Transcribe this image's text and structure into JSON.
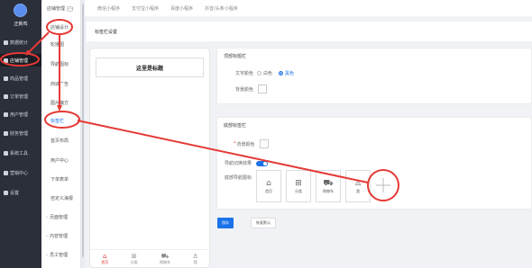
{
  "sidebar": {
    "shop_name": "正新鸡",
    "items": [
      {
        "label": "数据统计"
      },
      {
        "label": "店铺管理"
      },
      {
        "label": "商品管理"
      },
      {
        "label": "订单管理"
      },
      {
        "label": "用户管理"
      },
      {
        "label": "财务管理"
      },
      {
        "label": "系统工具"
      },
      {
        "label": "营销中心"
      },
      {
        "label": "设置"
      }
    ]
  },
  "submenu": {
    "title": "店铺管理",
    "collapse": "<<",
    "items": [
      {
        "label": "店铺设计"
      },
      {
        "label": "轮播图"
      },
      {
        "label": "导航图标"
      },
      {
        "label": "商城广告"
      },
      {
        "label": "图片魔方"
      },
      {
        "label": "标签栏"
      },
      {
        "label": "首页布局"
      },
      {
        "label": "用户中心"
      },
      {
        "label": "下单表单"
      },
      {
        "label": "自定义海报"
      },
      {
        "label": "页面管理"
      },
      {
        "label": "内容管理"
      },
      {
        "label": "员工管理"
      }
    ]
  },
  "top_tabs": [
    "微信小程序",
    "支付宝小程序",
    "百度小程序",
    "抖音/头条小程序"
  ],
  "page_title": "标签栏设置",
  "preview": {
    "title": "这里是标题",
    "tabs": [
      {
        "icon": "home-icon",
        "glyph": "⌂",
        "label": "首页"
      },
      {
        "icon": "grid-icon",
        "glyph": "⊞",
        "label": "分类"
      },
      {
        "icon": "cart-icon",
        "glyph": "⛟",
        "label": "购物车"
      },
      {
        "icon": "user-icon",
        "glyph": "♙",
        "label": "我"
      }
    ]
  },
  "settings": {
    "top_section_title": "顶部标题栏",
    "text_color_label": "文字颜色",
    "white_option": "白色",
    "black_option": "黑色",
    "bg_color_label": "背景颜色",
    "bottom_section_title": "底部标签栏",
    "bottom_bg_label": "背景颜色",
    "nav_effect_label": "导航切换效果",
    "nav_icons_label": "底部导航图标",
    "nav_icons": [
      {
        "icon": "home-icon",
        "glyph": "⌂",
        "label": "首页"
      },
      {
        "icon": "grid-icon",
        "glyph": "⊞",
        "label": "分类"
      },
      {
        "icon": "cart-icon",
        "glyph": "⛟",
        "label": "购物车"
      },
      {
        "icon": "user-icon",
        "glyph": "♙",
        "label": "我"
      }
    ],
    "save": "保存",
    "reset": "恢复默认"
  },
  "colors": {
    "annotation": "#e53935",
    "accent": "#1a73e8",
    "sidebar": "#2b2f3a"
  }
}
